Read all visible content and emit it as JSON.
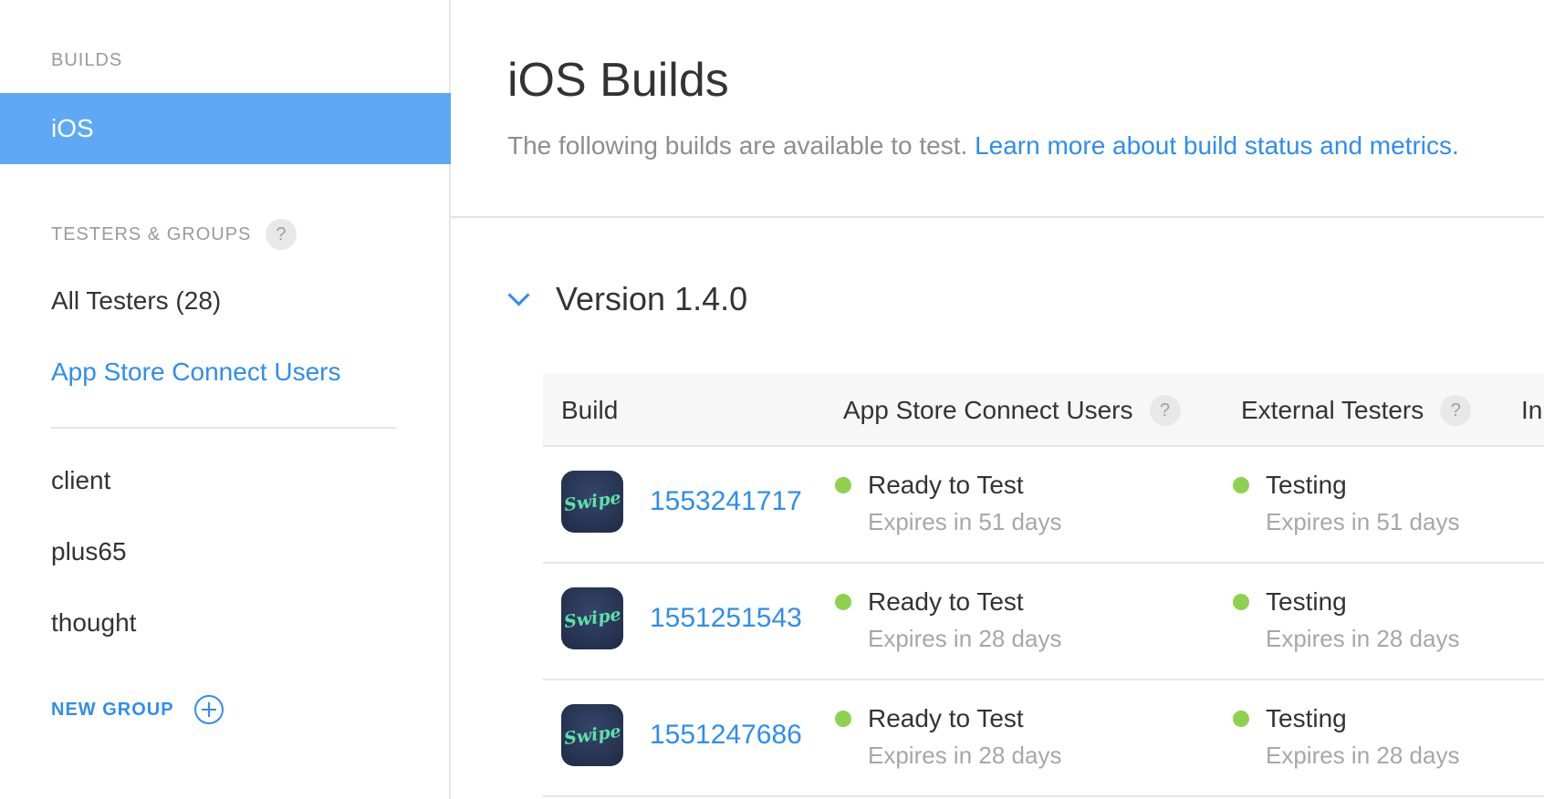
{
  "sidebar": {
    "builds_label": "BUILDS",
    "ios_label": "iOS",
    "testers_label": "TESTERS & GROUPS",
    "help_glyph": "?",
    "all_testers": "All Testers (28)",
    "connect_users": "App Store Connect Users",
    "groups": [
      "client",
      "plus65",
      "thought"
    ],
    "new_group": "NEW GROUP"
  },
  "main": {
    "title": "iOS Builds",
    "subtitle": "The following builds are available to test. ",
    "subtitle_link": "Learn more about build status and metrics.",
    "version": "Version 1.4.0"
  },
  "table": {
    "headers": {
      "build": "Build",
      "connect_users": "App Store Connect Users",
      "external": "External Testers",
      "truncated": "In"
    },
    "icon_text": "Swipe",
    "rows": [
      {
        "build": "1553241717",
        "internal_status": "Ready to Test",
        "internal_expiry": "Expires in 51 days",
        "external_status": "Testing",
        "external_expiry": "Expires in 51 days"
      },
      {
        "build": "1551251543",
        "internal_status": "Ready to Test",
        "internal_expiry": "Expires in 28 days",
        "external_status": "Testing",
        "external_expiry": "Expires in 28 days"
      },
      {
        "build": "1551247686",
        "internal_status": "Ready to Test",
        "internal_expiry": "Expires in 28 days",
        "external_status": "Testing",
        "external_expiry": "Expires in 28 days"
      }
    ]
  },
  "colors": {
    "accent": "#2f8df0",
    "selected_bg": "#5fa8f5",
    "status_green": "#8fd14f"
  }
}
